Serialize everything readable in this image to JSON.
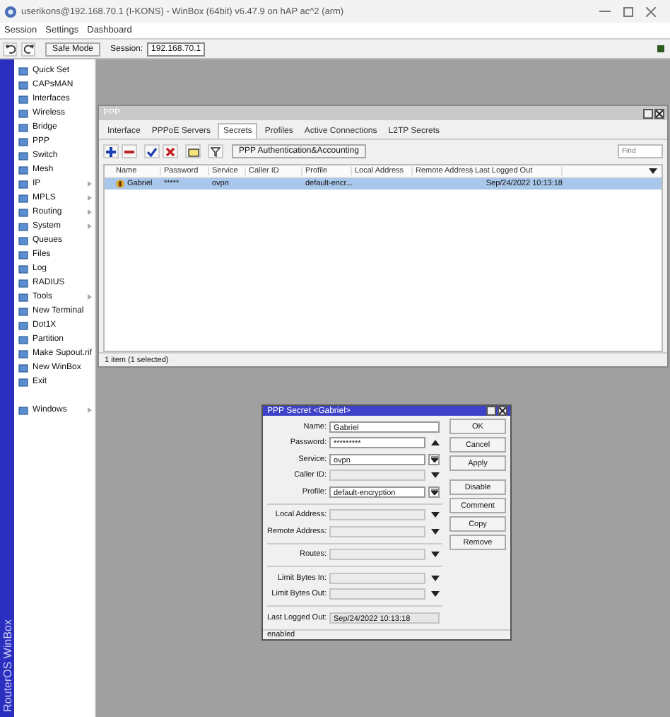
{
  "window": {
    "title": "userikons@192.168.70.1 (I-KONS) - WinBox (64bit) v6.47.9 on hAP ac^2 (arm)"
  },
  "menu": [
    "Session",
    "Settings",
    "Dashboard"
  ],
  "toolbar": {
    "safe_mode": "Safe Mode",
    "session_label": "Session:",
    "session_value": "192.168.70.1"
  },
  "brand": "RouterOS WinBox",
  "sidebar": {
    "items": [
      {
        "label": "Quick Set",
        "submenu": false
      },
      {
        "label": "CAPsMAN",
        "submenu": false
      },
      {
        "label": "Interfaces",
        "submenu": false
      },
      {
        "label": "Wireless",
        "submenu": false
      },
      {
        "label": "Bridge",
        "submenu": false
      },
      {
        "label": "PPP",
        "submenu": false
      },
      {
        "label": "Switch",
        "submenu": false
      },
      {
        "label": "Mesh",
        "submenu": false
      },
      {
        "label": "IP",
        "submenu": true
      },
      {
        "label": "MPLS",
        "submenu": true
      },
      {
        "label": "Routing",
        "submenu": true
      },
      {
        "label": "System",
        "submenu": true
      },
      {
        "label": "Queues",
        "submenu": false
      },
      {
        "label": "Files",
        "submenu": false
      },
      {
        "label": "Log",
        "submenu": false
      },
      {
        "label": "RADIUS",
        "submenu": false
      },
      {
        "label": "Tools",
        "submenu": true
      },
      {
        "label": "New Terminal",
        "submenu": false
      },
      {
        "label": "Dot1X",
        "submenu": false
      },
      {
        "label": "Partition",
        "submenu": false
      },
      {
        "label": "Make Supout.rif",
        "submenu": false
      },
      {
        "label": "New WinBox",
        "submenu": false
      },
      {
        "label": "Exit",
        "submenu": false
      }
    ],
    "windows": {
      "label": "Windows",
      "submenu": true
    }
  },
  "ppp_window": {
    "title": "PPP",
    "tabs": [
      {
        "label": "Interface",
        "selected": false
      },
      {
        "label": "PPPoE Servers",
        "selected": false
      },
      {
        "label": "Secrets",
        "selected": true
      },
      {
        "label": "Profiles",
        "selected": false
      },
      {
        "label": "Active Connections",
        "selected": false
      },
      {
        "label": "L2TP Secrets",
        "selected": false
      }
    ],
    "accounting_button": "PPP Authentication&Accounting",
    "find": {
      "placeholder": "Find"
    },
    "table": {
      "columns": [
        "Name",
        "Password",
        "Service",
        "Caller ID",
        "Profile",
        "Local Address",
        "Remote Address",
        "Last Logged Out"
      ],
      "rows": [
        {
          "selected": true,
          "cells": [
            "Gabriel",
            "*****",
            "ovpn",
            "",
            "default-encr...",
            "",
            "",
            "Sep/24/2022 10:13:18"
          ]
        }
      ]
    },
    "status": "1 item (1 selected)"
  },
  "dialog": {
    "title": "PPP Secret <Gabriel>",
    "field_groups": [
      [
        {
          "label": "Name:",
          "value": "Gabriel",
          "kind": "text"
        },
        {
          "label": "Password:",
          "value": "*********",
          "kind": "password"
        },
        {
          "label": "Service:",
          "value": "ovpn",
          "kind": "select"
        },
        {
          "label": "Caller ID:",
          "kind": "expand"
        },
        {
          "label": "Profile:",
          "value": "default-encryption",
          "kind": "select"
        }
      ],
      [
        {
          "label": "Local Address:",
          "kind": "expand"
        },
        {
          "label": "Remote Address:",
          "kind": "expand"
        }
      ],
      [
        {
          "label": "Routes:",
          "kind": "expand"
        }
      ],
      [
        {
          "label": "Limit Bytes In:",
          "kind": "expand"
        },
        {
          "label": "Limit Bytes Out:",
          "kind": "expand"
        }
      ],
      [
        {
          "label": "Last Logged Out:",
          "value": "Sep/24/2022 10:13:18",
          "kind": "readonly"
        }
      ]
    ],
    "button_groups": [
      [
        "OK",
        "Cancel",
        "Apply"
      ],
      [
        "Disable",
        "Comment",
        "Copy",
        "Remove"
      ]
    ],
    "status": "enabled"
  }
}
